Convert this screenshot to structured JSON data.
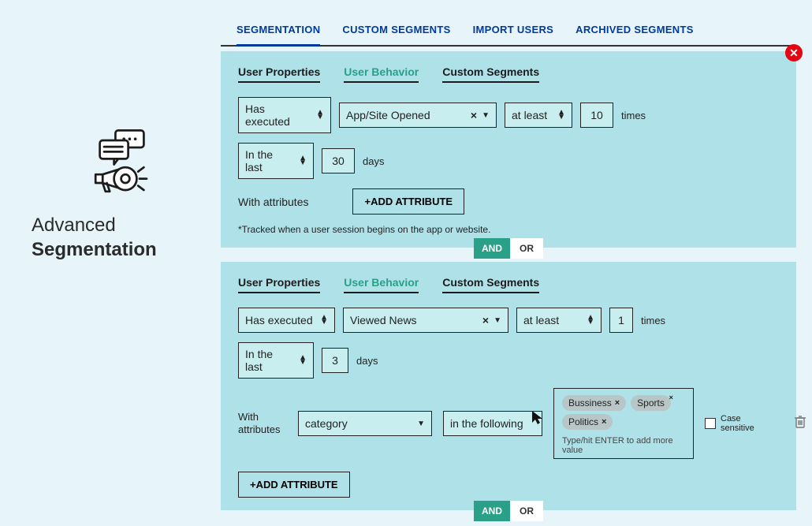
{
  "sidebar": {
    "title_light": "Advanced",
    "title_bold": "Segmentation"
  },
  "tabs": {
    "items": [
      "SEGMENTATION",
      "CUSTOM SEGMENTS",
      "IMPORT USERS",
      "ARCHIVED SEGMENTS"
    ],
    "active_index": 0
  },
  "sub_tabs": {
    "items": [
      "User Properties",
      "User Behavior",
      "Custom Segments"
    ],
    "active_index": 1
  },
  "panel1": {
    "executed": "Has executed",
    "event": "App/Site Opened",
    "at_least": "at least",
    "times_val": "10",
    "times_lbl": "times",
    "in_last": "In the last",
    "days_val": "30",
    "days_lbl": "days",
    "with_attr": "With attributes",
    "add_attr": "+ADD ATTRIBUTE",
    "note": "*Tracked when a user session begins on the app or website."
  },
  "panel2": {
    "executed": "Has executed",
    "event": "Viewed News",
    "at_least": "at least",
    "times_val": "1",
    "times_lbl": "times",
    "in_last": "In the last",
    "days_val": "3",
    "days_lbl": "days",
    "with_attr": "With attributes",
    "attr_name": "category",
    "in_following": "in the following",
    "chips": [
      "Bussiness",
      "Sports",
      "Politics"
    ],
    "chip_hint": "Type/hit ENTER to add more value",
    "case_sensitive": "Case sensitive",
    "add_attr": "+ADD ATTRIBUTE"
  },
  "connector": {
    "and": "AND",
    "or": "OR"
  }
}
